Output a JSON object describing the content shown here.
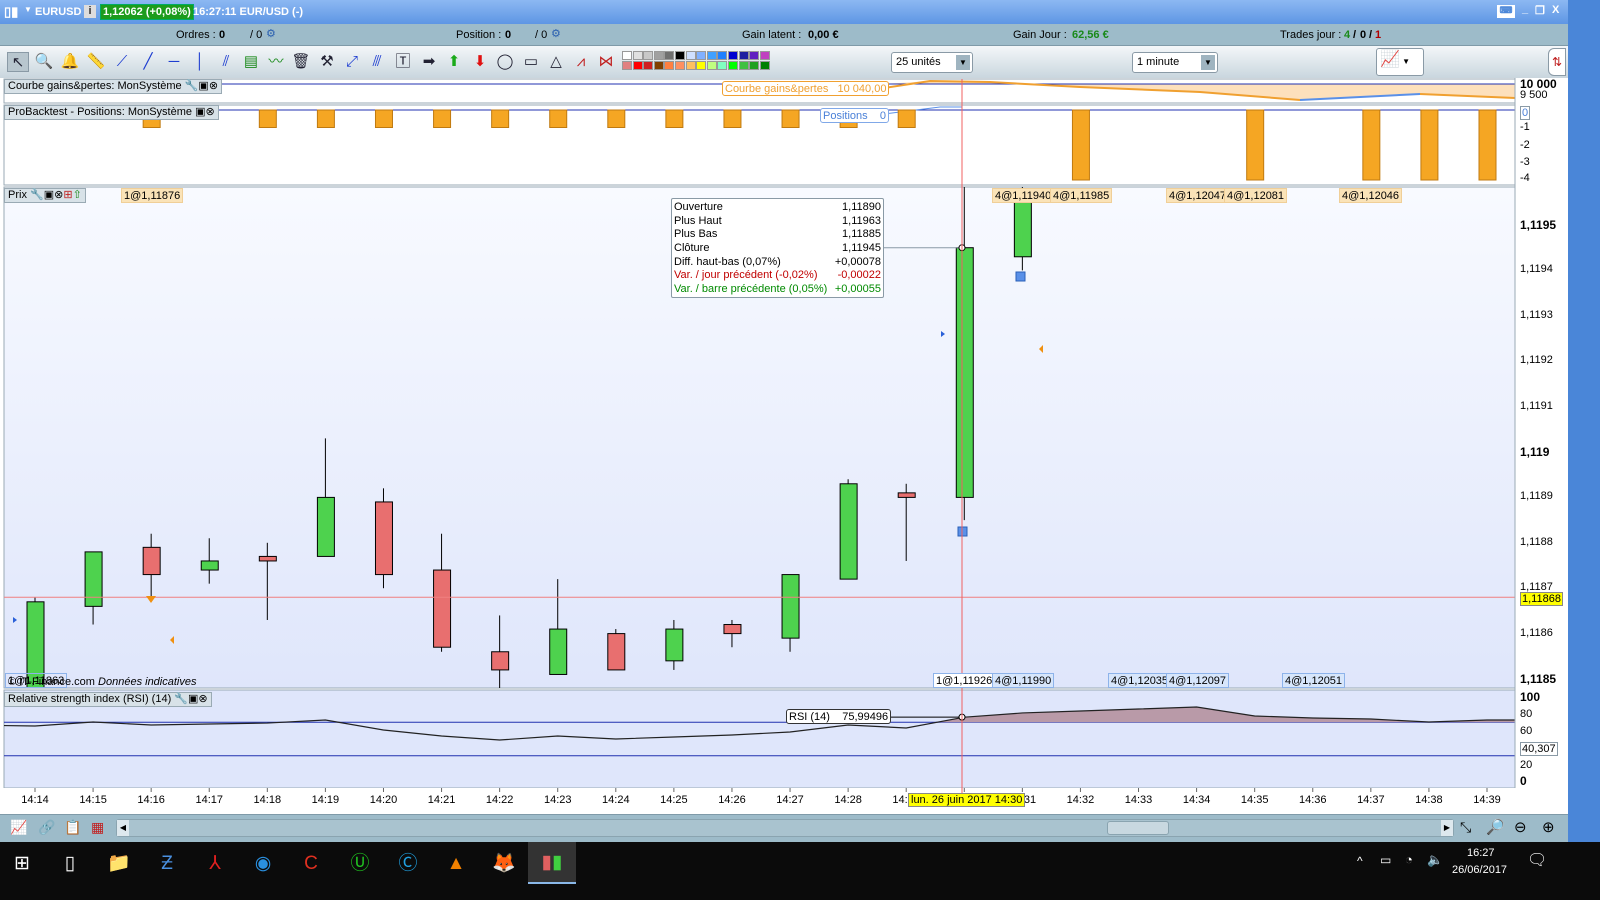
{
  "titlebar": {
    "symbol": "EURUSD",
    "price_badge": "1,12062 (+0,08%)",
    "time_instrument": "16:27:11 EUR/USD (-)"
  },
  "infobar": {
    "orders_label": "Ordres :",
    "orders_value": "0",
    "orders_total": "/ 0",
    "position_label": "Position :",
    "position_value": "0",
    "position_total": "/ 0",
    "latent_label": "Gain latent :",
    "latent_value": "0,00 €",
    "day_gain_label": "Gain Jour :",
    "day_gain_value": "62,56 €",
    "trades_label": "Trades jour :",
    "trades_win": "4",
    "trades_zero": "0",
    "trades_loss": "1"
  },
  "toolbar": {
    "quantity_select": "25 unités",
    "timeframe_select": "1 minute",
    "palette_row1": [
      "#ffffff",
      "#e0e0e0",
      "#c8c8c8",
      "#a0a0a0",
      "#707070",
      "#000000",
      "#d0e0ff",
      "#80b0ff",
      "#40a0ff",
      "#2080ff",
      "#0000d0",
      "#2020a0",
      "#6020c0",
      "#c040c0"
    ],
    "palette_row2": [
      "#e08080",
      "#ff0000",
      "#d02020",
      "#804000",
      "#ff8040",
      "#ff9060",
      "#ffc060",
      "#ffff00",
      "#c0ff80",
      "#80ffc0",
      "#00ff00",
      "#40c040",
      "#20a020",
      "#008000"
    ]
  },
  "panels": {
    "equity": {
      "title": "Courbe gains&pertes: MonSystème",
      "legend_label": "Courbe gains&pertes",
      "legend_value": "10 040,00",
      "ticks": [
        "10 000",
        "9 500"
      ]
    },
    "positions": {
      "title": "ProBacktest - Positions: MonSystème",
      "legend_label": "Positions",
      "legend_value": "0",
      "ticks": [
        "0",
        "-1",
        "-2",
        "-3",
        "-4"
      ]
    },
    "price": {
      "title": "Prix",
      "ticks": [
        "1,1195",
        "1,1194",
        "1,1193",
        "1,1192",
        "1,1191",
        "1,119",
        "1,1189",
        "1,1188",
        "1,1187",
        "1,1186",
        "1,1185"
      ],
      "current_price": "1,11868",
      "source": "© IT-Finance.com",
      "disclaimer": "Données indicatives"
    },
    "rsi": {
      "title": "Relative strength index (RSI) (14)",
      "legend": "RSI (14)",
      "legend_value": "75,99496",
      "ticks": [
        "100",
        "80",
        "60",
        "20",
        "0"
      ],
      "cursor_value": "40,307"
    }
  },
  "tooltip": [
    {
      "label": "Ouverture",
      "value": "1,11890",
      "color": "#000000"
    },
    {
      "label": "Plus Haut",
      "value": "1,11963",
      "color": "#000000"
    },
    {
      "label": "Plus Bas",
      "value": "1,11885",
      "color": "#000000"
    },
    {
      "label": "Clôture",
      "value": "1,11945",
      "color": "#000000"
    },
    {
      "label": "Diff. haut-bas (0,07%)",
      "value": "+0,00078",
      "color": "#000000"
    },
    {
      "label": "Var. / jour précédent (-0,02%)",
      "value": "-0,00022",
      "color": "#c00000"
    },
    {
      "label": "Var. / barre précédente (0,05%)",
      "value": "+0,00055",
      "color": "#008a00"
    }
  ],
  "trade_tags_top": [
    "1@1,11876",
    "4@1,11940",
    "4@1,11985",
    "4@1,12047",
    "4@1,12081",
    "4@1,12046"
  ],
  "trade_tags_bottom": [
    "1@1,11863",
    "1@1,11926",
    "4@1,11990",
    "4@1,12035",
    "4@1,12097",
    "4@1,12051"
  ],
  "chart_data": {
    "type": "candlestick",
    "x": [
      "14:14",
      "14:15",
      "14:16",
      "14:17",
      "14:18",
      "14:19",
      "14:20",
      "14:21",
      "14:22",
      "14:23",
      "14:24",
      "14:25",
      "14:26",
      "14:27",
      "14:28",
      "14:29",
      "14:30",
      "14:31",
      "14:32",
      "14:33",
      "14:34",
      "14:35",
      "14:36",
      "14:37",
      "14:38",
      "14:39"
    ],
    "ohlc": [
      [
        1.11848,
        1.11868,
        1.11845,
        1.11867
      ],
      [
        1.11866,
        1.11878,
        1.11862,
        1.11878
      ],
      [
        1.11879,
        1.11882,
        1.11868,
        1.11873
      ],
      [
        1.11874,
        1.11881,
        1.11871,
        1.11876
      ],
      [
        1.11877,
        1.1188,
        1.11863,
        1.11876
      ],
      [
        1.11877,
        1.11903,
        1.11877,
        1.1189
      ],
      [
        1.11889,
        1.11892,
        1.1187,
        1.11873
      ],
      [
        1.11874,
        1.11882,
        1.11856,
        1.11857
      ],
      [
        1.11856,
        1.11864,
        1.11848,
        1.11852
      ],
      [
        1.11851,
        1.11872,
        1.11851,
        1.11861
      ],
      [
        1.1186,
        1.11861,
        1.11852,
        1.11852
      ],
      [
        1.11854,
        1.11863,
        1.11852,
        1.11861
      ],
      [
        1.11862,
        1.11863,
        1.11857,
        1.1186
      ],
      [
        1.11859,
        1.11873,
        1.11856,
        1.11873
      ],
      [
        1.11872,
        1.11894,
        1.11872,
        1.11893
      ],
      [
        1.11891,
        1.11893,
        1.11876,
        1.1189
      ],
      [
        1.1189,
        1.11963,
        1.11885,
        1.11945
      ],
      [
        1.11943,
        1.1196,
        1.1194,
        1.11955
      ]
    ],
    "ylim": [
      1.1185,
      1.1195
    ],
    "positions": [
      0,
      0,
      -1,
      0,
      -1,
      -1,
      -1,
      -1,
      -1,
      -1,
      -1,
      -1,
      -1,
      -1,
      -1,
      -1,
      0,
      0,
      -4,
      0,
      0,
      -4,
      0,
      -4,
      -4,
      -4
    ],
    "rsi": [
      65.5,
      70.2,
      66.7,
      67.9,
      69,
      72.6,
      60.7,
      53.6,
      48.8,
      53.6,
      50,
      52.4,
      54.8,
      58.3,
      66.7,
      63.1,
      76.0,
      81,
      83.3,
      85.7,
      88.1,
      77.4,
      75,
      73.8,
      70.2,
      72.6
    ],
    "rsi_levels": [
      70,
      30
    ],
    "cursor_label": "lun. 26 juin 2017 14:30"
  },
  "taskbar": {
    "clock_time": "16:27",
    "clock_date": "26/06/2017"
  }
}
